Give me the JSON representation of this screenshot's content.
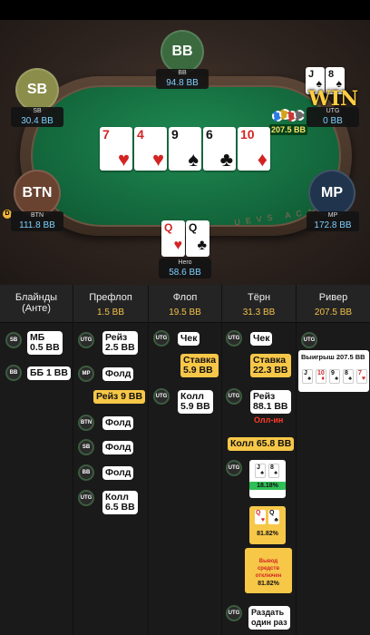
{
  "table": {
    "watermark": "UEVS ACA",
    "seats": {
      "bb": {
        "badge": "BB",
        "name": "BB",
        "stack": "94.8 BB"
      },
      "sb": {
        "badge": "SB",
        "name": "SB",
        "stack": "30.4 BB"
      },
      "btn": {
        "badge": "BTN",
        "name": "BTN",
        "stack": "111.8 BB"
      },
      "mp": {
        "badge": "MP",
        "name": "MP",
        "stack": "172.8 BB"
      },
      "utg": {
        "name": "UTG",
        "stack": "0 BB"
      },
      "hero": {
        "name": "Hero",
        "stack": "58.6 BB"
      }
    },
    "dealer_button": "D",
    "pot": "207.5 BB",
    "win_label": "WIN",
    "utg_cards": [
      {
        "rank": "J",
        "suit": "♠"
      },
      {
        "rank": "8",
        "suit": "♠"
      }
    ],
    "board": [
      {
        "rank": "7",
        "suit": "♥",
        "color": "#d32424"
      },
      {
        "rank": "4",
        "suit": "♥",
        "color": "#d32424"
      },
      {
        "rank": "9",
        "suit": "♠",
        "color": "#111111"
      },
      {
        "rank": "6",
        "suit": "♣",
        "color": "#111111"
      },
      {
        "rank": "10",
        "suit": "♦",
        "color": "#d32424"
      }
    ],
    "hero_cards": [
      {
        "rank": "Q",
        "suit": "♥",
        "color": "#d32424"
      },
      {
        "rank": "Q",
        "suit": "♣",
        "color": "#111111"
      }
    ]
  },
  "history": {
    "columns": [
      {
        "title": "Блайнды (Анте)",
        "pot": ""
      },
      {
        "title": "Префлоп",
        "pot": "1.5 BB"
      },
      {
        "title": "Флоп",
        "pot": "19.5 BB"
      },
      {
        "title": "Тёрн",
        "pot": "31.3 BB"
      },
      {
        "title": "Ривер",
        "pot": "207.5 BB"
      }
    ],
    "blinds": {
      "sb": {
        "pos": "SB",
        "line1": "МБ",
        "line2": "0.5 BB"
      },
      "bb": {
        "pos": "BB",
        "line1": "ББ 1 BB"
      }
    },
    "preflop": {
      "utg": {
        "pos": "UTG",
        "line1": "Рейз",
        "line2": "2.5 BB"
      },
      "mp": {
        "pos": "MP",
        "line1": "Фолд"
      },
      "hero": {
        "line1": "Рейз 9 BB"
      },
      "btn": {
        "pos": "BTN",
        "line1": "Фолд"
      },
      "sb": {
        "pos": "SB",
        "line1": "Фолд"
      },
      "bb": {
        "pos": "BB",
        "line1": "Фолд"
      },
      "utg2": {
        "pos": "UTG",
        "line1": "Колл",
        "line2": "6.5 BB"
      }
    },
    "flop": {
      "utg": {
        "pos": "UTG",
        "line1": "Чек"
      },
      "hero": {
        "line1": "Ставка",
        "line2": "5.9 BB"
      },
      "utg2": {
        "pos": "UTG",
        "line1": "Колл",
        "line2": "5.9 BB"
      }
    },
    "turn": {
      "utg": {
        "pos": "UTG",
        "line1": "Чек"
      },
      "hero": {
        "line1": "Ставка",
        "line2": "22.3 BB"
      },
      "utg2": {
        "pos": "UTG",
        "line1": "Рейз",
        "line2": "88.1 BB"
      },
      "allin": "Олл-ин",
      "hero_call": "Колл 65.8 BB",
      "utg3": {
        "pos": "UTG",
        "equity": "18.18%"
      },
      "hero_equity": "81.82%",
      "cashout_label": "Вывод средств отключен",
      "cashout_equity": "81.82%",
      "utg4": {
        "pos": "UTG",
        "line1": "Раздать",
        "line2": "один раз"
      }
    },
    "river": {
      "utg": {
        "pos": "UTG"
      },
      "winner_text": "Выигрыш 207.5 BB",
      "cards": [
        {
          "rank": "J",
          "suit": "♠",
          "color": "#111111"
        },
        {
          "rank": "10",
          "suit": "♦",
          "color": "#d32424"
        },
        {
          "rank": "9",
          "suit": "♠",
          "color": "#111111"
        },
        {
          "rank": "8",
          "suit": "♠",
          "color": "#111111"
        },
        {
          "rank": "7",
          "suit": "♥",
          "color": "#d32424"
        }
      ]
    }
  }
}
